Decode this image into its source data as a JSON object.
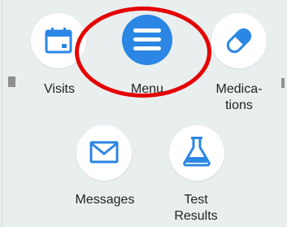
{
  "colors": {
    "background": "#e9eeef",
    "accent_blue": "#2b86e4",
    "highlight_red": "#e50000",
    "tile_white": "#ffffff"
  },
  "tiles": [
    {
      "id": "visits",
      "label": "Visits",
      "icon": "calendar-icon"
    },
    {
      "id": "menu",
      "label": "Menu",
      "icon": "hamburger-menu-icon"
    },
    {
      "id": "medications",
      "label": "Medica-\ntions",
      "icon": "pill-capsule-icon"
    },
    {
      "id": "messages",
      "label": "Messages",
      "icon": "envelope-icon"
    },
    {
      "id": "test_results",
      "label": "Test\nResults",
      "icon": "flask-icon"
    }
  ]
}
